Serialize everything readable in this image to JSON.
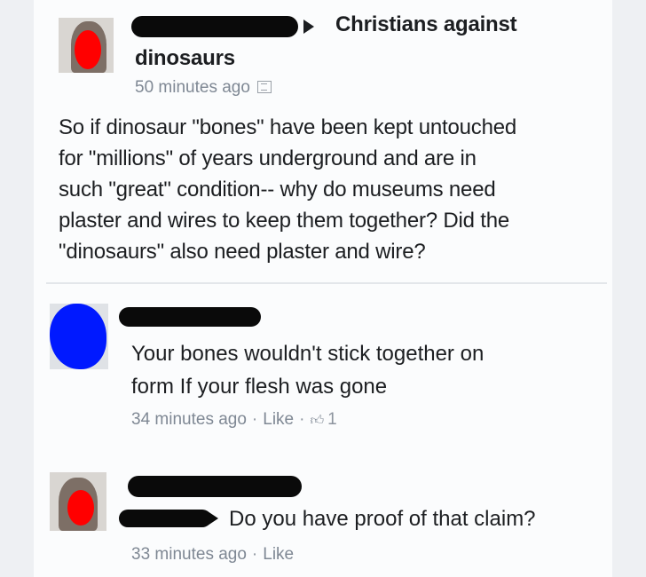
{
  "post": {
    "group_line1": "Christians against",
    "group_line2": "dinosaurs",
    "timestamp": "50 minutes ago",
    "privacy_icon": "globe-icon",
    "text_lines": [
      "So if dinosaur \"bones\" have been kept untouched",
      "for \"millions\" of years underground and are in",
      "such \"great\" condition-- why do museums need",
      "plaster and wires to keep them together?  Did the",
      "\"dinosaurs\" also need plaster and wire?"
    ]
  },
  "comments": [
    {
      "text_lines": [
        "Your bones wouldn't stick together on",
        "form If your flesh was gone"
      ],
      "timestamp": "34 minutes ago",
      "like_label": "Like",
      "like_count": "1",
      "like_icon": "thumbs-up-icon"
    },
    {
      "text": "Do you have proof of that claim?",
      "timestamp": "33 minutes ago",
      "like_label": "Like"
    }
  ],
  "colors": {
    "text": "#1c1e21",
    "meta": "#8d949e",
    "redaction": "#0a0a0a",
    "avatar_red": "#ff0000",
    "avatar_blue": "#0019ff"
  }
}
